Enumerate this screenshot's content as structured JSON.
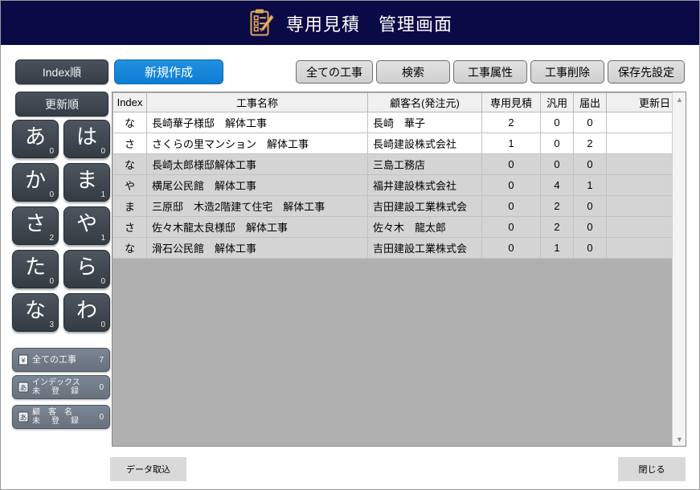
{
  "window": {
    "title": "専用見積　管理画面",
    "title_icon": "clipboard-quote-icon",
    "title_bg": "#0a0a46",
    "accent_blue": "#0d7ed4"
  },
  "toolbar": {
    "sort_index_label": "Index順",
    "sort_update_label": "更新順",
    "new_label": "新規作成",
    "buttons": [
      {
        "name": "all-works",
        "label": "全ての工事"
      },
      {
        "name": "search",
        "label": "検索"
      },
      {
        "name": "work-attribute",
        "label": "工事属性"
      },
      {
        "name": "work-delete",
        "label": "工事削除"
      },
      {
        "name": "save-destination",
        "label": "保存先設定"
      }
    ]
  },
  "kana_pad": [
    {
      "char": "あ",
      "count": "0"
    },
    {
      "char": "は",
      "count": "0"
    },
    {
      "char": "か",
      "count": "0"
    },
    {
      "char": "ま",
      "count": "1"
    },
    {
      "char": "さ",
      "count": "2"
    },
    {
      "char": "や",
      "count": "1"
    },
    {
      "char": "た",
      "count": "0"
    },
    {
      "char": "ら",
      "count": "0"
    },
    {
      "char": "な",
      "count": "3"
    },
    {
      "char": "わ",
      "count": "0"
    }
  ],
  "filters": [
    {
      "name": "all-works",
      "icon": "document-yen-icon",
      "label": "全ての工事",
      "label2": "",
      "count": "7"
    },
    {
      "name": "index-unregistered",
      "icon": "kana-box-icon",
      "label": "インデックス",
      "label2": "未　登　録",
      "count": "0"
    },
    {
      "name": "customer-unregistered",
      "icon": "kana-box-icon",
      "label": "顧　客　名",
      "label2": "未　登　録",
      "count": "0"
    }
  ],
  "table": {
    "headers": {
      "index": "Index",
      "name": "工事名称",
      "customer": "顧客名(発注元)",
      "quote": "専用見積",
      "general": "汎用",
      "notify": "届出",
      "updated": "更新日"
    },
    "rows": [
      {
        "index": "な",
        "name": "長崎華子様邸　解体工事",
        "customer": "長崎　華子",
        "quote": "2",
        "general": "0",
        "notify": "0",
        "updated": "",
        "shade": "white"
      },
      {
        "index": "さ",
        "name": "さくらの里マンション　解体工事",
        "customer": "長崎建設株式会社",
        "quote": "1",
        "general": "0",
        "notify": "2",
        "updated": "",
        "shade": "white"
      },
      {
        "index": "な",
        "name": "長崎太郎様邸解体工事",
        "customer": "三島工務店",
        "quote": "0",
        "general": "0",
        "notify": "0",
        "updated": "",
        "shade": "gray"
      },
      {
        "index": "や",
        "name": "横尾公民館　解体工事",
        "customer": "福井建設株式会社",
        "quote": "0",
        "general": "4",
        "notify": "1",
        "updated": "",
        "shade": "gray"
      },
      {
        "index": "ま",
        "name": "三原邸　木造2階建て住宅　解体工事",
        "customer": "吉田建設工業株式会",
        "quote": "0",
        "general": "2",
        "notify": "0",
        "updated": "",
        "shade": "gray"
      },
      {
        "index": "さ",
        "name": "佐々木龍太良様邸　解体工事",
        "customer": "佐々木　龍太郎",
        "quote": "0",
        "general": "2",
        "notify": "0",
        "updated": "",
        "shade": "gray"
      },
      {
        "index": "な",
        "name": "滑石公民館　解体工事",
        "customer": "吉田建設工業株式会",
        "quote": "0",
        "general": "1",
        "notify": "0",
        "updated": "",
        "shade": "gray"
      }
    ],
    "scrollbar": {
      "up_icon": "chevron-up-icon",
      "down_icon": "chevron-down-icon"
    }
  },
  "footer": {
    "import_label": "データ取込",
    "close_label": "閉じる"
  }
}
